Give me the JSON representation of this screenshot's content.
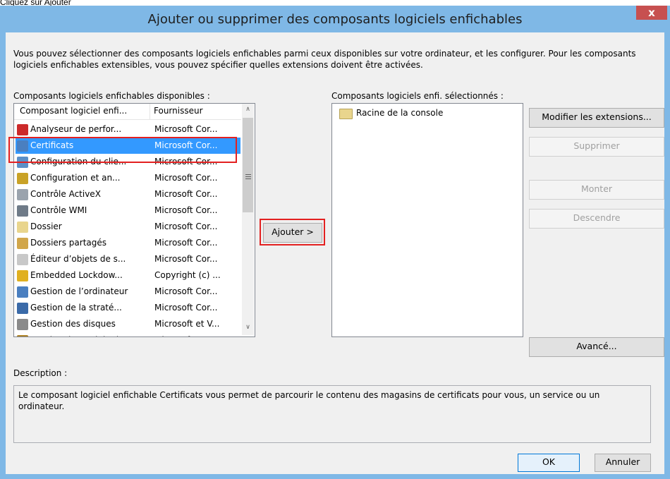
{
  "caption": "Cliquez sur Ajouter",
  "window": {
    "title": "Ajouter ou supprimer des composants logiciels enfichables",
    "close_glyph": "x"
  },
  "intro_text": "Vous pouvez sélectionner des composants logiciels enfichables parmi ceux disponibles sur votre ordinateur, et les configurer. Pour les composants logiciels enfichables extensibles, vous pouvez spécifier quelles extensions doivent être activées.",
  "available": {
    "label": "Composants logiciels enfichables disponibles :",
    "columns": [
      "Composant logiciel enfi...",
      "Fournisseur"
    ],
    "items": [
      {
        "name": "Analyseur de perfor...",
        "vendor": "Microsoft Cor...",
        "icon": "performance-icon",
        "color": "#cc2a2a"
      },
      {
        "name": "Certificats",
        "vendor": "Microsoft Cor...",
        "icon": "certificate-icon",
        "color": "#4a7fc0",
        "selected": true
      },
      {
        "name": "Configuration du clie...",
        "vendor": "Microsoft Cor...",
        "icon": "client-config-icon",
        "color": "#5b8fc7"
      },
      {
        "name": "Configuration et an...",
        "vendor": "Microsoft Cor...",
        "icon": "security-config-icon",
        "color": "#c9a227"
      },
      {
        "name": "Contrôle ActiveX",
        "vendor": "Microsoft Cor...",
        "icon": "activex-icon",
        "color": "#9aa3ad"
      },
      {
        "name": "Contrôle WMI",
        "vendor": "Microsoft Cor...",
        "icon": "wmi-icon",
        "color": "#6f7b88"
      },
      {
        "name": "Dossier",
        "vendor": "Microsoft Cor...",
        "icon": "folder-icon",
        "color": "#e9d58d"
      },
      {
        "name": "Dossiers partagés",
        "vendor": "Microsoft Cor...",
        "icon": "shared-folder-icon",
        "color": "#d1a64a"
      },
      {
        "name": "Éditeur d’objets de s...",
        "vendor": "Microsoft Cor...",
        "icon": "policy-editor-icon",
        "color": "#c8c8c8"
      },
      {
        "name": "Embedded Lockdow...",
        "vendor": "Copyright (c) ...",
        "icon": "lock-icon",
        "color": "#e0b020"
      },
      {
        "name": "Gestion de l’ordinateur",
        "vendor": "Microsoft Cor...",
        "icon": "computer-management-icon",
        "color": "#4a7fc0"
      },
      {
        "name": "Gestion de la straté...",
        "vendor": "Microsoft Cor...",
        "icon": "group-policy-icon",
        "color": "#3a6aa8"
      },
      {
        "name": "Gestion des disques",
        "vendor": "Microsoft et V...",
        "icon": "disk-icon",
        "color": "#8a8a8a"
      },
      {
        "name": "Gestion du module d...",
        "vendor": "Microsoft Cor...",
        "icon": "tpm-icon",
        "color": "#b0852a"
      }
    ]
  },
  "selected": {
    "label": "Composants logiciels enfi. sélectionnés :",
    "items": [
      {
        "name": "Racine de la console",
        "icon": "folder-icon"
      }
    ]
  },
  "buttons": {
    "add": "Ajouter >",
    "edit_extensions": "Modifier les extensions...",
    "remove": "Supprimer",
    "move_up": "Monter",
    "move_down": "Descendre",
    "advanced": "Avancé...",
    "ok": "OK",
    "cancel": "Annuler"
  },
  "description": {
    "label": "Description :",
    "text": "Le composant logiciel enfichable Certificats vous permet de parcourir le contenu des magasins de certificats pour vous, un service ou un ordinateur."
  },
  "colors": {
    "accent": "#3399ff",
    "highlight_box": "#e32020",
    "window_frame": "#7fb8e6"
  }
}
